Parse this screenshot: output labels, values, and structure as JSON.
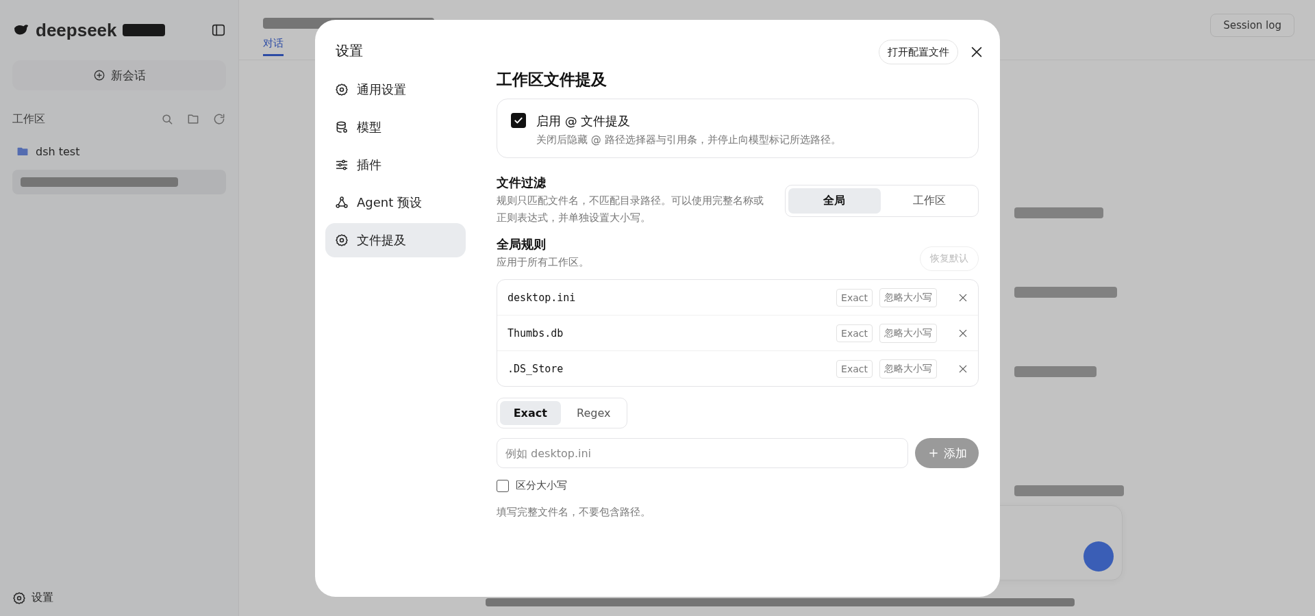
{
  "app": {
    "logo": "deepseek",
    "new_chat": "新会话",
    "workspace_label": "工作区",
    "projects": [
      {
        "name": "dsh test"
      }
    ],
    "tabs": [
      {
        "label": "对话",
        "selected": true
      }
    ],
    "session_log": "Session log",
    "settings": "设置"
  },
  "dialog": {
    "title": "设置",
    "open_config": "打开配置文件",
    "nav": [
      {
        "label": "通用设置",
        "kind": "gear",
        "selected": false
      },
      {
        "label": "模型",
        "kind": "database",
        "selected": false
      },
      {
        "label": "插件",
        "kind": "sliders",
        "selected": false
      },
      {
        "label": "Agent 预设",
        "kind": "nodes",
        "selected": false
      },
      {
        "label": "文件提及",
        "kind": "gear",
        "selected": true
      }
    ],
    "section_title": "工作区文件提及",
    "mention_toggle": {
      "label": "启用 @ 文件提及",
      "description": "关闭后隐藏 @ 路径选择器与引用条，并停止向模型标记所选路径。",
      "checked": true
    },
    "filter": {
      "title": "文件过滤",
      "description": "规则只匹配文件名，不匹配目录路径。可以使用完整名称或正则表达式，并单独设置大小写。",
      "scopes": [
        {
          "label": "全局",
          "selected": true
        },
        {
          "label": "工作区",
          "selected": false
        }
      ]
    },
    "rules": {
      "title": "全局规则",
      "description": "应用于所有工作区。",
      "reset": "恢复默认",
      "reset_disabled": true,
      "items": [
        {
          "pattern": "desktop.ini",
          "match": "Exact",
          "case": "忽略大小写"
        },
        {
          "pattern": "Thumbs.db",
          "match": "Exact",
          "case": "忽略大小写"
        },
        {
          "pattern": ".DS_Store",
          "match": "Exact",
          "case": "忽略大小写"
        }
      ]
    },
    "modes": [
      {
        "label": "Exact",
        "selected": true
      },
      {
        "label": "Regex",
        "selected": false
      }
    ],
    "input": {
      "placeholder": "例如 desktop.ini"
    },
    "add_button": {
      "label": "添加",
      "disabled": true
    },
    "case_sensitive": {
      "label": "区分大小写",
      "checked": false
    },
    "hint": "填写完整文件名，不要包含路径。"
  }
}
